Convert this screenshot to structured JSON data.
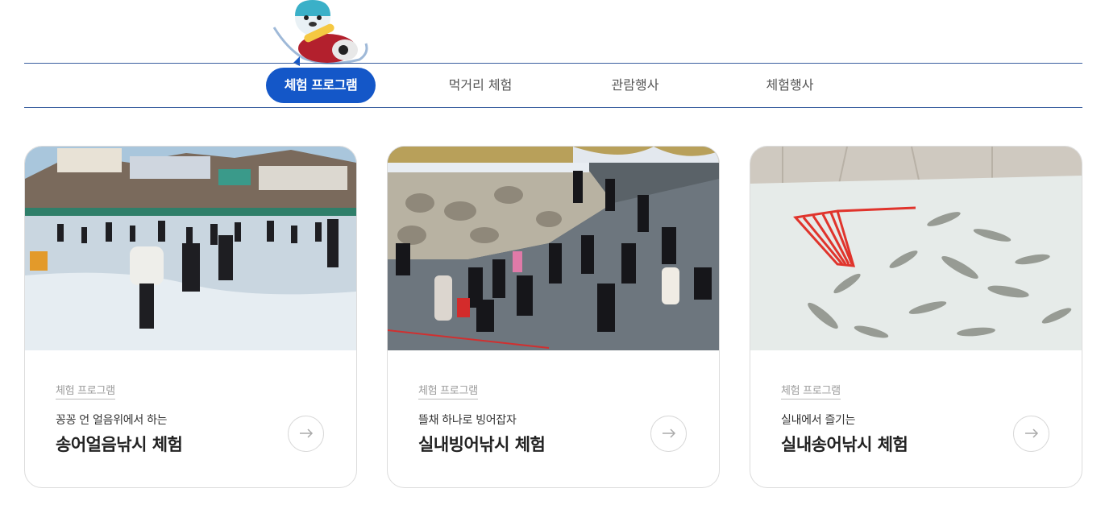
{
  "mascot": {
    "icon": "seal-mascot-on-sled-icon"
  },
  "tabs": [
    {
      "label": "체험 프로그램",
      "active": true
    },
    {
      "label": "먹거리 체험",
      "active": false
    },
    {
      "label": "관람행사",
      "active": false
    },
    {
      "label": "체험행사",
      "active": false
    }
  ],
  "cards": [
    {
      "category": "체험 프로그램",
      "subtitle": "꽁꽁 언 얼음위에서 하는",
      "title": "송어얼음낚시 체험",
      "arrow_icon": "arrow-right-icon"
    },
    {
      "category": "체험 프로그램",
      "subtitle": "뜰채 하나로 빙어잡자",
      "title": "실내빙어낚시 체험",
      "arrow_icon": "arrow-right-icon"
    },
    {
      "category": "체험 프로그램",
      "subtitle": "실내에서 즐기는",
      "title": "실내송어낚시 체험",
      "arrow_icon": "arrow-right-icon"
    }
  ],
  "colors": {
    "accent": "#1457c8",
    "rule": "#3a5f9f",
    "card_border": "#dcdcdc"
  }
}
